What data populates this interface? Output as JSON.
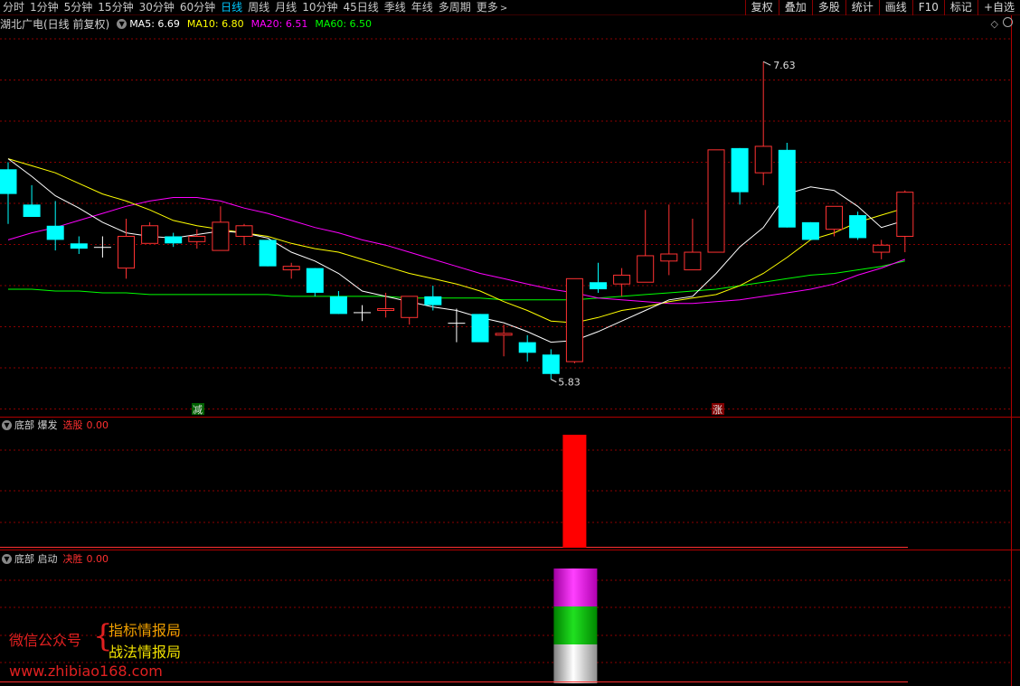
{
  "toolbar": {
    "periods": [
      {
        "label": "分时",
        "active": false
      },
      {
        "label": "1分钟",
        "active": false
      },
      {
        "label": "5分钟",
        "active": false
      },
      {
        "label": "15分钟",
        "active": false
      },
      {
        "label": "30分钟",
        "active": false
      },
      {
        "label": "60分钟",
        "active": false
      },
      {
        "label": "日线",
        "active": true
      },
      {
        "label": "周线",
        "active": false
      },
      {
        "label": "月线",
        "active": false
      },
      {
        "label": "10分钟",
        "active": false
      },
      {
        "label": "45日线",
        "active": false
      },
      {
        "label": "季线",
        "active": false
      },
      {
        "label": "年线",
        "active": false
      },
      {
        "label": "多周期",
        "active": false
      }
    ],
    "more_label": "更多",
    "right_buttons": [
      "复权",
      "叠加",
      "多股",
      "统计",
      "画线",
      "F10",
      "标记",
      "+自选"
    ]
  },
  "main_panel": {
    "stock_title": "湖北广电(日线 前复权)",
    "ma_labels": [
      {
        "text": "MA5: 6.69",
        "color": "#ffffff"
      },
      {
        "text": "MA10: 6.80",
        "color": "#ffff00"
      },
      {
        "text": "MA20: 6.51",
        "color": "#ff00ff"
      },
      {
        "text": "MA60: 6.50",
        "color": "#00ff00"
      }
    ],
    "high_label": "7.63",
    "low_label": "5.83",
    "marker_left": "减",
    "marker_right": "涨"
  },
  "panel2": {
    "title": "底部 爆发",
    "value_label": "选股",
    "value": "0.00"
  },
  "panel3": {
    "title": "底部 启动",
    "value_label": "决胜",
    "value": "0.00"
  },
  "watermark": {
    "left_text": "微信公众号",
    "right_line1": "指标情报局",
    "right_line2": "战法情报局",
    "url": "www.zhibiao168.com"
  },
  "chart_data": {
    "type": "candlestick",
    "ylim": [
      5.7,
      7.8
    ],
    "candles": [
      {
        "o": 7.02,
        "h": 7.06,
        "l": 6.71,
        "c": 6.88
      },
      {
        "o": 6.82,
        "h": 6.93,
        "l": 6.75,
        "c": 6.75
      },
      {
        "o": 6.7,
        "h": 6.84,
        "l": 6.56,
        "c": 6.62
      },
      {
        "o": 6.6,
        "h": 6.64,
        "l": 6.54,
        "c": 6.57
      },
      {
        "o": 6.58,
        "h": 6.64,
        "l": 6.52,
        "c": 6.58
      },
      {
        "o": 6.46,
        "h": 6.74,
        "l": 6.4,
        "c": 6.64
      },
      {
        "o": 6.6,
        "h": 6.72,
        "l": 6.6,
        "c": 6.7
      },
      {
        "o": 6.64,
        "h": 6.66,
        "l": 6.58,
        "c": 6.6
      },
      {
        "o": 6.61,
        "h": 6.68,
        "l": 6.57,
        "c": 6.64
      },
      {
        "o": 6.56,
        "h": 6.81,
        "l": 6.56,
        "c": 6.72
      },
      {
        "o": 6.64,
        "h": 6.71,
        "l": 6.59,
        "c": 6.7
      },
      {
        "o": 6.62,
        "h": 6.62,
        "l": 6.47,
        "c": 6.47
      },
      {
        "o": 6.45,
        "h": 6.49,
        "l": 6.4,
        "c": 6.47
      },
      {
        "o": 6.46,
        "h": 6.46,
        "l": 6.3,
        "c": 6.32
      },
      {
        "o": 6.3,
        "h": 6.33,
        "l": 6.2,
        "c": 6.2
      },
      {
        "o": 6.21,
        "h": 6.25,
        "l": 6.16,
        "c": 6.21
      },
      {
        "o": 6.22,
        "h": 6.32,
        "l": 6.18,
        "c": 6.23
      },
      {
        "o": 6.18,
        "h": 6.3,
        "l": 6.14,
        "c": 6.3
      },
      {
        "o": 6.3,
        "h": 6.36,
        "l": 6.22,
        "c": 6.25
      },
      {
        "o": 6.15,
        "h": 6.23,
        "l": 6.04,
        "c": 6.15
      },
      {
        "o": 6.2,
        "h": 6.2,
        "l": 6.05,
        "c": 6.04
      },
      {
        "o": 6.08,
        "h": 6.14,
        "l": 5.96,
        "c": 6.09
      },
      {
        "o": 6.04,
        "h": 6.08,
        "l": 5.93,
        "c": 5.98
      },
      {
        "o": 5.97,
        "h": 6.0,
        "l": 5.83,
        "c": 5.86
      },
      {
        "o": 5.93,
        "h": 6.4,
        "l": 5.92,
        "c": 6.4
      },
      {
        "o": 6.38,
        "h": 6.49,
        "l": 6.32,
        "c": 6.34
      },
      {
        "o": 6.37,
        "h": 6.46,
        "l": 6.3,
        "c": 6.42
      },
      {
        "o": 6.38,
        "h": 6.79,
        "l": 6.38,
        "c": 6.53
      },
      {
        "o": 6.5,
        "h": 6.82,
        "l": 6.42,
        "c": 6.54
      },
      {
        "o": 6.45,
        "h": 6.74,
        "l": 6.45,
        "c": 6.55
      },
      {
        "o": 6.55,
        "h": 7.13,
        "l": 6.55,
        "c": 7.13
      },
      {
        "o": 7.14,
        "h": 7.14,
        "l": 6.82,
        "c": 6.89
      },
      {
        "o": 7.0,
        "h": 7.63,
        "l": 6.93,
        "c": 7.15
      },
      {
        "o": 7.13,
        "h": 7.17,
        "l": 6.69,
        "c": 6.69
      },
      {
        "o": 6.72,
        "h": 6.72,
        "l": 6.62,
        "c": 6.62
      },
      {
        "o": 6.68,
        "h": 6.81,
        "l": 6.64,
        "c": 6.81
      },
      {
        "o": 6.76,
        "h": 6.78,
        "l": 6.62,
        "c": 6.63
      },
      {
        "o": 6.55,
        "h": 6.62,
        "l": 6.51,
        "c": 6.59
      },
      {
        "o": 6.64,
        "h": 6.9,
        "l": 6.55,
        "c": 6.89
      }
    ],
    "ma5": [
      7.08,
      6.98,
      6.87,
      6.8,
      6.72,
      6.66,
      6.64,
      6.63,
      6.65,
      6.67,
      6.66,
      6.63,
      6.55,
      6.5,
      6.43,
      6.33,
      6.3,
      6.27,
      6.24,
      6.22,
      6.18,
      6.15,
      6.1,
      6.04,
      6.05,
      6.1,
      6.16,
      6.22,
      6.28,
      6.3,
      6.43,
      6.58,
      6.69,
      6.88,
      6.92,
      6.9,
      6.81,
      6.69,
      6.73
    ],
    "ma10": [
      7.08,
      7.04,
      7.0,
      6.94,
      6.88,
      6.84,
      6.79,
      6.73,
      6.7,
      6.68,
      6.66,
      6.64,
      6.6,
      6.57,
      6.55,
      6.51,
      6.47,
      6.43,
      6.4,
      6.37,
      6.33,
      6.27,
      6.22,
      6.16,
      6.15,
      6.18,
      6.22,
      6.24,
      6.27,
      6.29,
      6.31,
      6.36,
      6.43,
      6.52,
      6.62,
      6.66,
      6.72,
      6.76,
      6.8
    ],
    "ma20": [
      6.62,
      6.66,
      6.69,
      6.73,
      6.77,
      6.81,
      6.84,
      6.86,
      6.86,
      6.84,
      6.8,
      6.77,
      6.73,
      6.69,
      6.66,
      6.62,
      6.59,
      6.55,
      6.51,
      6.47,
      6.43,
      6.4,
      6.37,
      6.34,
      6.32,
      6.29,
      6.28,
      6.27,
      6.26,
      6.26,
      6.27,
      6.28,
      6.3,
      6.32,
      6.34,
      6.37,
      6.42,
      6.46,
      6.51
    ],
    "ma60": [
      6.34,
      6.34,
      6.33,
      6.33,
      6.32,
      6.32,
      6.31,
      6.31,
      6.31,
      6.31,
      6.31,
      6.31,
      6.3,
      6.3,
      6.3,
      6.3,
      6.3,
      6.29,
      6.29,
      6.29,
      6.29,
      6.28,
      6.28,
      6.28,
      6.28,
      6.29,
      6.3,
      6.31,
      6.32,
      6.33,
      6.34,
      6.36,
      6.38,
      6.4,
      6.42,
      6.43,
      6.45,
      6.47,
      6.5
    ],
    "signal_panel2_index": 24,
    "signal_panel3_index": 24
  },
  "colors": {
    "up": "#ff3232",
    "down": "#00ffff",
    "ma5": "#ffffff",
    "ma10": "#ffff00",
    "ma20": "#ff00ff",
    "ma60": "#00ff00",
    "grid": "#8b0000",
    "border": "#b00000"
  }
}
